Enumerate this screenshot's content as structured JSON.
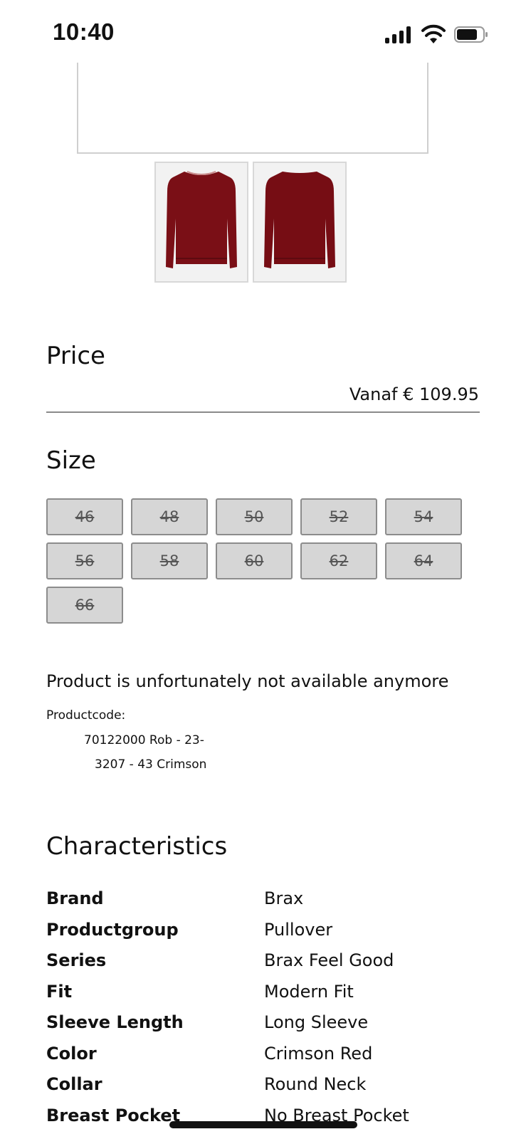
{
  "status_bar": {
    "time": "10:40",
    "icons": [
      "signal-icon",
      "wifi-icon",
      "battery-icon"
    ]
  },
  "gallery": {
    "thumbnails": [
      {
        "name": "front-view",
        "color": "#7a0f16"
      },
      {
        "name": "back-view",
        "color": "#7a0f16"
      }
    ]
  },
  "price": {
    "title": "Price",
    "value": "Vanaf € 109.95"
  },
  "size": {
    "title": "Size",
    "options": [
      "46",
      "48",
      "50",
      "52",
      "54",
      "56",
      "58",
      "60",
      "62",
      "64",
      "66"
    ]
  },
  "availability": {
    "message": "Product is unfortunately not available anymore",
    "productcode_label": "Productcode:",
    "productcode_line1": "70122000 Rob - 23-",
    "productcode_line2": "3207 - 43 Crimson"
  },
  "characteristics": {
    "title": "Characteristics",
    "rows": [
      {
        "key": "Brand",
        "value": "Brax"
      },
      {
        "key": "Productgroup",
        "value": "Pullover"
      },
      {
        "key": "Series",
        "value": "Brax Feel Good"
      },
      {
        "key": "Fit",
        "value": "Modern Fit"
      },
      {
        "key": "Sleeve Length",
        "value": "Long Sleeve"
      },
      {
        "key": "Color",
        "value": "Crimson Red"
      },
      {
        "key": "Collar",
        "value": "Round Neck"
      },
      {
        "key": "Breast Pocket",
        "value": "No Breast Pocket"
      }
    ]
  }
}
